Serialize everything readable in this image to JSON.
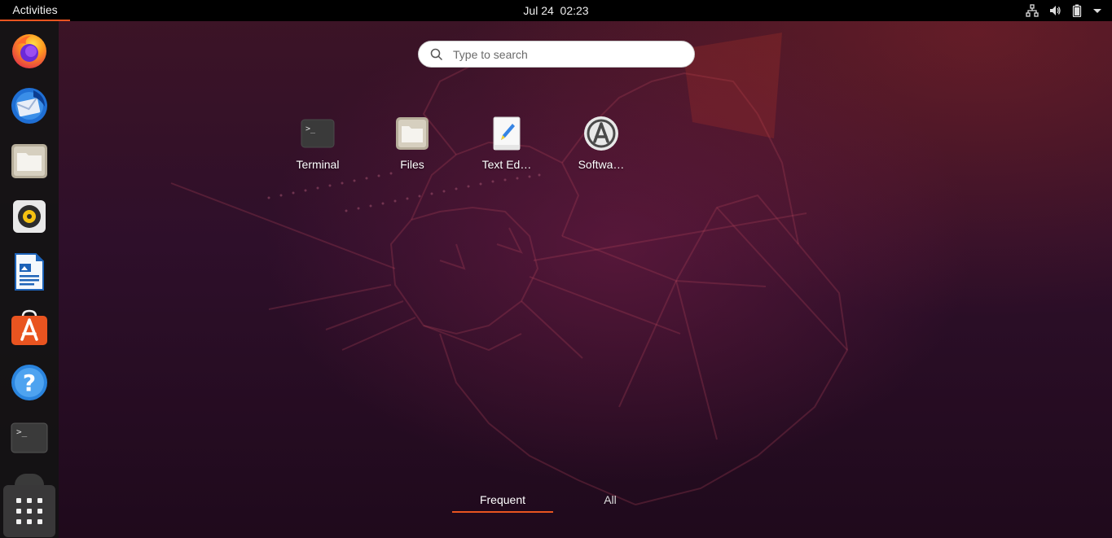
{
  "topbar": {
    "activities_label": "Activities",
    "date": "Jul 24",
    "time": "02:23",
    "tray_icons": [
      "network-icon",
      "volume-icon",
      "battery-icon",
      "system-menu-arrow-icon"
    ]
  },
  "dock": {
    "items": [
      {
        "name": "Firefox",
        "icon": "firefox-icon"
      },
      {
        "name": "Thunderbird",
        "icon": "thunderbird-icon"
      },
      {
        "name": "Files",
        "icon": "files-icon"
      },
      {
        "name": "Rhythmbox",
        "icon": "rhythmbox-icon"
      },
      {
        "name": "LibreOffice Writer",
        "icon": "writer-icon"
      },
      {
        "name": "Ubuntu Software",
        "icon": "software-center-icon"
      },
      {
        "name": "Help",
        "icon": "help-icon"
      },
      {
        "name": "Terminal",
        "icon": "terminal-icon"
      }
    ],
    "show_apps_icon": "grid-icon"
  },
  "search": {
    "placeholder": "Type to search",
    "value": ""
  },
  "apps": [
    {
      "label": "Terminal",
      "icon": "terminal-icon"
    },
    {
      "label": "Files",
      "icon": "files-icon"
    },
    {
      "label": "Text Ed…",
      "icon": "text-editor-icon"
    },
    {
      "label": "Softwa…",
      "icon": "software-updater-icon"
    }
  ],
  "tabs": {
    "frequent": "Frequent",
    "all": "All"
  },
  "colors": {
    "accent": "#e95420",
    "topbar": "#000000",
    "dock": "#141414"
  }
}
